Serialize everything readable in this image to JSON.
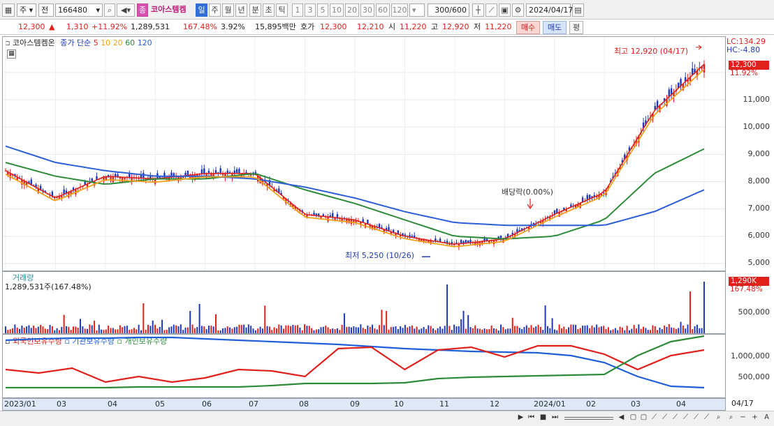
{
  "toolbar": {
    "market": "주",
    "prev": "전",
    "code": "166480",
    "badge": "종",
    "name": "코아스템켐",
    "periods": [
      "일",
      "주",
      "월",
      "년",
      "분",
      "초",
      "틱"
    ],
    "active_period": "일",
    "minutes": [
      "1",
      "3",
      "5",
      "10",
      "20",
      "30",
      "60",
      "120"
    ],
    "count": "300",
    "count_total": "/600",
    "date": "2024/04/17"
  },
  "quote": {
    "price": "12,300",
    "change": "1,310",
    "pct": "+11.92%",
    "volume": "1,289,531",
    "vol_ratio": "167.48%",
    "turnover": "3.92%",
    "amount": "15,895백만",
    "ask_label": "호가",
    "ask1": "12,300",
    "ask2": "12,210",
    "open_label": "시",
    "open": "11,220",
    "high_label": "고",
    "high": "12,920",
    "low_label": "저",
    "low": "11,220",
    "buy": "매수",
    "sell": "매도",
    "eval": "평"
  },
  "price_pane": {
    "legend_name": "코아스템켐온",
    "legend_type": "종가 단순",
    "ma_periods": [
      "5",
      "10",
      "20",
      "60",
      "120"
    ],
    "ma_colors": [
      "#e0201b",
      "#f2a31a",
      "#f2a31a",
      "#2e8b3a",
      "#2c5fd8"
    ],
    "lc_label": "LC:134.29",
    "hc_label": "HC:-4.80",
    "price_tag": "12,300",
    "pct_tag": "11.92%",
    "high_note": "최고 12,920 (04/17)",
    "low_note": "최저 5,250 (10/26)",
    "dividend_note": "배당락(0.00%)",
    "yticks": [
      "11,000",
      "10,000",
      "9,000",
      "8,000",
      "7,000",
      "6,000",
      "5,000"
    ]
  },
  "volume_pane": {
    "title": "거래량",
    "value": "1,289,531주(167.48%)",
    "tag": "1,290K",
    "pct_tag": "167.48%",
    "ytick": "500,000"
  },
  "holding_pane": {
    "legend": [
      "외국인보유수량",
      "기관보유수량",
      "개인보유수량"
    ],
    "colors": [
      "#e0201b",
      "#1f5fd8",
      "#2e8b3a"
    ],
    "yticks": [
      "1,000,000",
      "500,000"
    ]
  },
  "xaxis": {
    "labels": [
      "2023/01",
      "03",
      "04",
      "05",
      "06",
      "07",
      "08",
      "09",
      "10",
      "11",
      "12",
      "2024/01",
      "02",
      "03",
      "04"
    ],
    "current": "04/17"
  },
  "chart_data": {
    "type": "line",
    "title": "코아스템켐온",
    "x": [
      "2023/01",
      "2023/03",
      "2023/04",
      "2023/05",
      "2023/06",
      "2023/07",
      "2023/08",
      "2023/09",
      "2023/10",
      "2023/11",
      "2023/12",
      "2024/01",
      "2024/02",
      "2024/03",
      "2024/04"
    ],
    "series": [
      {
        "name": "5",
        "values": [
          8400,
          7400,
          8200,
          8100,
          8300,
          8300,
          6800,
          6600,
          6000,
          5700,
          5900,
          6800,
          7600,
          10600,
          12300
        ]
      },
      {
        "name": "60",
        "values": [
          8700,
          8200,
          7900,
          8100,
          8100,
          8300,
          7700,
          7200,
          6600,
          6000,
          5900,
          6000,
          6600,
          8300,
          9200
        ]
      },
      {
        "name": "120",
        "values": [
          9300,
          8700,
          8400,
          8200,
          8200,
          8100,
          7800,
          7400,
          6900,
          6500,
          6400,
          6400,
          6400,
          6900,
          7700
        ]
      }
    ],
    "ylim": [
      5000,
      13000
    ],
    "high": {
      "value": 12920,
      "date": "04/17"
    },
    "low": {
      "value": 5250,
      "date": "10/26"
    }
  }
}
